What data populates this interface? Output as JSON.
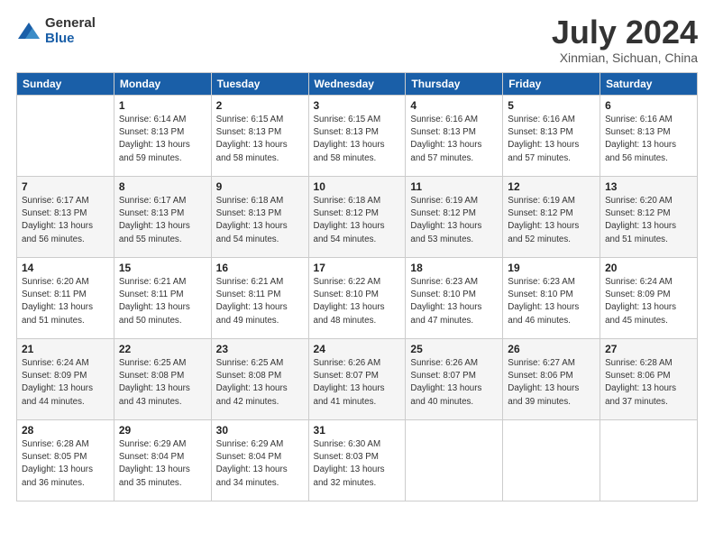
{
  "app": {
    "logo_general": "General",
    "logo_blue": "Blue",
    "month_title": "July 2024",
    "location": "Xinmian, Sichuan, China"
  },
  "days_of_week": [
    "Sunday",
    "Monday",
    "Tuesday",
    "Wednesday",
    "Thursday",
    "Friday",
    "Saturday"
  ],
  "weeks": [
    [
      {
        "day": "",
        "sunrise": "",
        "sunset": "",
        "daylight": ""
      },
      {
        "day": "1",
        "sunrise": "Sunrise: 6:14 AM",
        "sunset": "Sunset: 8:13 PM",
        "daylight": "Daylight: 13 hours and 59 minutes."
      },
      {
        "day": "2",
        "sunrise": "Sunrise: 6:15 AM",
        "sunset": "Sunset: 8:13 PM",
        "daylight": "Daylight: 13 hours and 58 minutes."
      },
      {
        "day": "3",
        "sunrise": "Sunrise: 6:15 AM",
        "sunset": "Sunset: 8:13 PM",
        "daylight": "Daylight: 13 hours and 58 minutes."
      },
      {
        "day": "4",
        "sunrise": "Sunrise: 6:16 AM",
        "sunset": "Sunset: 8:13 PM",
        "daylight": "Daylight: 13 hours and 57 minutes."
      },
      {
        "day": "5",
        "sunrise": "Sunrise: 6:16 AM",
        "sunset": "Sunset: 8:13 PM",
        "daylight": "Daylight: 13 hours and 57 minutes."
      },
      {
        "day": "6",
        "sunrise": "Sunrise: 6:16 AM",
        "sunset": "Sunset: 8:13 PM",
        "daylight": "Daylight: 13 hours and 56 minutes."
      }
    ],
    [
      {
        "day": "7",
        "sunrise": "Sunrise: 6:17 AM",
        "sunset": "Sunset: 8:13 PM",
        "daylight": "Daylight: 13 hours and 56 minutes."
      },
      {
        "day": "8",
        "sunrise": "Sunrise: 6:17 AM",
        "sunset": "Sunset: 8:13 PM",
        "daylight": "Daylight: 13 hours and 55 minutes."
      },
      {
        "day": "9",
        "sunrise": "Sunrise: 6:18 AM",
        "sunset": "Sunset: 8:13 PM",
        "daylight": "Daylight: 13 hours and 54 minutes."
      },
      {
        "day": "10",
        "sunrise": "Sunrise: 6:18 AM",
        "sunset": "Sunset: 8:12 PM",
        "daylight": "Daylight: 13 hours and 54 minutes."
      },
      {
        "day": "11",
        "sunrise": "Sunrise: 6:19 AM",
        "sunset": "Sunset: 8:12 PM",
        "daylight": "Daylight: 13 hours and 53 minutes."
      },
      {
        "day": "12",
        "sunrise": "Sunrise: 6:19 AM",
        "sunset": "Sunset: 8:12 PM",
        "daylight": "Daylight: 13 hours and 52 minutes."
      },
      {
        "day": "13",
        "sunrise": "Sunrise: 6:20 AM",
        "sunset": "Sunset: 8:12 PM",
        "daylight": "Daylight: 13 hours and 51 minutes."
      }
    ],
    [
      {
        "day": "14",
        "sunrise": "Sunrise: 6:20 AM",
        "sunset": "Sunset: 8:11 PM",
        "daylight": "Daylight: 13 hours and 51 minutes."
      },
      {
        "day": "15",
        "sunrise": "Sunrise: 6:21 AM",
        "sunset": "Sunset: 8:11 PM",
        "daylight": "Daylight: 13 hours and 50 minutes."
      },
      {
        "day": "16",
        "sunrise": "Sunrise: 6:21 AM",
        "sunset": "Sunset: 8:11 PM",
        "daylight": "Daylight: 13 hours and 49 minutes."
      },
      {
        "day": "17",
        "sunrise": "Sunrise: 6:22 AM",
        "sunset": "Sunset: 8:10 PM",
        "daylight": "Daylight: 13 hours and 48 minutes."
      },
      {
        "day": "18",
        "sunrise": "Sunrise: 6:23 AM",
        "sunset": "Sunset: 8:10 PM",
        "daylight": "Daylight: 13 hours and 47 minutes."
      },
      {
        "day": "19",
        "sunrise": "Sunrise: 6:23 AM",
        "sunset": "Sunset: 8:10 PM",
        "daylight": "Daylight: 13 hours and 46 minutes."
      },
      {
        "day": "20",
        "sunrise": "Sunrise: 6:24 AM",
        "sunset": "Sunset: 8:09 PM",
        "daylight": "Daylight: 13 hours and 45 minutes."
      }
    ],
    [
      {
        "day": "21",
        "sunrise": "Sunrise: 6:24 AM",
        "sunset": "Sunset: 8:09 PM",
        "daylight": "Daylight: 13 hours and 44 minutes."
      },
      {
        "day": "22",
        "sunrise": "Sunrise: 6:25 AM",
        "sunset": "Sunset: 8:08 PM",
        "daylight": "Daylight: 13 hours and 43 minutes."
      },
      {
        "day": "23",
        "sunrise": "Sunrise: 6:25 AM",
        "sunset": "Sunset: 8:08 PM",
        "daylight": "Daylight: 13 hours and 42 minutes."
      },
      {
        "day": "24",
        "sunrise": "Sunrise: 6:26 AM",
        "sunset": "Sunset: 8:07 PM",
        "daylight": "Daylight: 13 hours and 41 minutes."
      },
      {
        "day": "25",
        "sunrise": "Sunrise: 6:26 AM",
        "sunset": "Sunset: 8:07 PM",
        "daylight": "Daylight: 13 hours and 40 minutes."
      },
      {
        "day": "26",
        "sunrise": "Sunrise: 6:27 AM",
        "sunset": "Sunset: 8:06 PM",
        "daylight": "Daylight: 13 hours and 39 minutes."
      },
      {
        "day": "27",
        "sunrise": "Sunrise: 6:28 AM",
        "sunset": "Sunset: 8:06 PM",
        "daylight": "Daylight: 13 hours and 37 minutes."
      }
    ],
    [
      {
        "day": "28",
        "sunrise": "Sunrise: 6:28 AM",
        "sunset": "Sunset: 8:05 PM",
        "daylight": "Daylight: 13 hours and 36 minutes."
      },
      {
        "day": "29",
        "sunrise": "Sunrise: 6:29 AM",
        "sunset": "Sunset: 8:04 PM",
        "daylight": "Daylight: 13 hours and 35 minutes."
      },
      {
        "day": "30",
        "sunrise": "Sunrise: 6:29 AM",
        "sunset": "Sunset: 8:04 PM",
        "daylight": "Daylight: 13 hours and 34 minutes."
      },
      {
        "day": "31",
        "sunrise": "Sunrise: 6:30 AM",
        "sunset": "Sunset: 8:03 PM",
        "daylight": "Daylight: 13 hours and 32 minutes."
      },
      {
        "day": "",
        "sunrise": "",
        "sunset": "",
        "daylight": ""
      },
      {
        "day": "",
        "sunrise": "",
        "sunset": "",
        "daylight": ""
      },
      {
        "day": "",
        "sunrise": "",
        "sunset": "",
        "daylight": ""
      }
    ]
  ]
}
